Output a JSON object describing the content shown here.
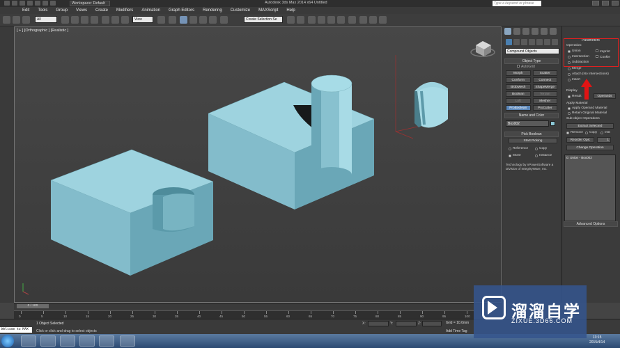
{
  "titlebar": {
    "workspace": "Workspace: Default",
    "app_title": "Autodesk 3ds Max  2014 x64      Untitled",
    "search_placeholder": "Type a keyword or phrase"
  },
  "menu": [
    "Edit",
    "Tools",
    "Group",
    "Views",
    "Create",
    "Modifiers",
    "Animation",
    "Graph Editors",
    "Rendering",
    "Customize",
    "MAXScript",
    "Help"
  ],
  "toolbar": {
    "filter_value": "All",
    "view_value": "View",
    "selection_set_value": "Create Selection Se"
  },
  "viewport": {
    "label": "[ + ] [Orthographic ] [Realistic ]"
  },
  "command_panel": {
    "category": "Compound Objects",
    "object_type_header": "Object Type",
    "autogrid": "AutoGrid",
    "buttons": [
      {
        "label": "Morph",
        "state": "normal"
      },
      {
        "label": "Scatter",
        "state": "normal"
      },
      {
        "label": "Conform",
        "state": "normal"
      },
      {
        "label": "Connect",
        "state": "normal"
      },
      {
        "label": "BlobMesh",
        "state": "normal"
      },
      {
        "label": "ShapeMerge",
        "state": "normal"
      },
      {
        "label": "Boolean",
        "state": "normal"
      },
      {
        "label": "Terrain",
        "state": "dim"
      },
      {
        "label": "Loft",
        "state": "dim"
      },
      {
        "label": "Mesher",
        "state": "normal"
      },
      {
        "label": "ProBoolean",
        "state": "active"
      },
      {
        "label": "ProCutter",
        "state": "normal"
      }
    ],
    "name_color_header": "Name and Color",
    "object_name": "Box002",
    "object_color": "#8cc8d6",
    "pick_boolean_header": "Pick Boolean",
    "start_picking": "Start Picking",
    "pick_options": [
      "Reference",
      "Copy",
      "Move",
      "Instance"
    ],
    "pick_selected": "Move",
    "info": "Technology by nPowerSoftware a Division of IntegrityWare, Inc."
  },
  "parameters": {
    "header": "Parameters",
    "operation_label": "Operation:",
    "operations": [
      "Union",
      "Intersection",
      "Subtraction",
      "Merge",
      "Attach (No Intersections)",
      "Insert"
    ],
    "operation_selected": "Union",
    "imprint": "Imprint",
    "cookie": "Cookie",
    "display_label": "Display",
    "display_result": "Result",
    "operands_button": "Operands",
    "apply_material_label": "Apply Material",
    "apply_options": [
      "Apply Operand Material",
      "Retain Original Material"
    ],
    "subobject_label": "Sub-object Operations",
    "extract_selected": "Extract Selected",
    "extract_options": [
      "Remove",
      "Copy",
      "Inst"
    ],
    "reorder_ops": "Reorder Ops:",
    "reorder_value": "1",
    "change_operation": "Change Operation",
    "operand_list_item": "0: Union - Box002",
    "advanced_options": "Advanced Options"
  },
  "timeline": {
    "slider": "0 / 100",
    "ticks": [
      "0",
      "5",
      "10",
      "15",
      "20",
      "25",
      "30",
      "35",
      "40",
      "45",
      "50",
      "55",
      "60",
      "65",
      "70",
      "75",
      "80",
      "85",
      "90",
      "95",
      "100"
    ]
  },
  "status": {
    "maxscript_label": "Welcome to MAX",
    "selection": "1 Object Selected",
    "hint": "Click or click-and-drag to select objects",
    "x_label": "X:",
    "y_label": "Y:",
    "z_label": "Z:",
    "grid": "Grid = 10.0mm",
    "add_time_tag": "Add Time Tag"
  },
  "taskbar": {
    "time": "13:15",
    "date": "2015/4/14"
  },
  "watermark": {
    "title": "溜溜自学",
    "url": "ZIXUE.3D66.COM"
  }
}
